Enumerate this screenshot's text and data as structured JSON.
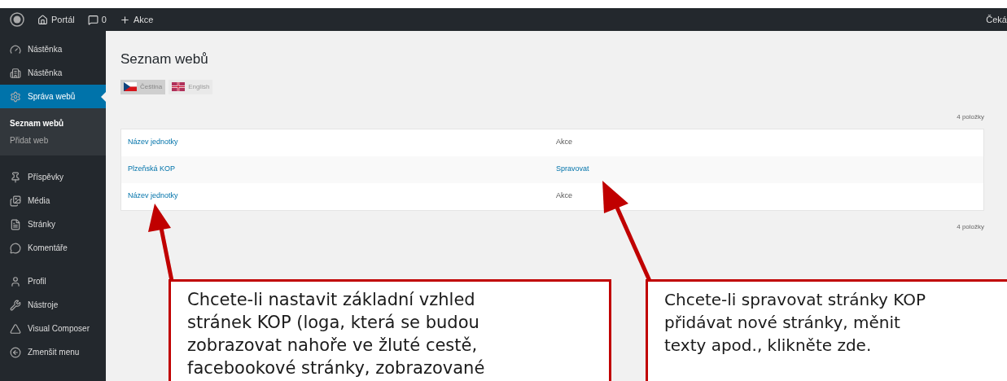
{
  "admin_bar": {
    "items": [
      {
        "kind": "home",
        "label": "Portál"
      },
      {
        "kind": "comments",
        "label": "0"
      },
      {
        "kind": "new",
        "label": "Akce"
      }
    ],
    "user": "Čeká"
  },
  "sidebar": {
    "groups": [
      [
        {
          "label": "Nástěnka",
          "selected": false
        },
        {
          "label": "Nástěnka",
          "selected": false
        },
        {
          "label": "Správa webů",
          "selected": true,
          "children": [
            {
              "label": "Seznam webů",
              "selected": true
            },
            {
              "label": "Přidat web",
              "selected": false
            }
          ]
        }
      ],
      [
        {
          "label": "Příspěvky",
          "selected": false
        },
        {
          "label": "Média",
          "selected": false
        },
        {
          "label": "Stránky",
          "selected": false
        },
        {
          "label": "Komentáře",
          "selected": false
        }
      ],
      [
        {
          "label": "Profil",
          "selected": false
        },
        {
          "label": "Nástroje",
          "selected": false
        },
        {
          "label": "Visual Composer",
          "selected": false
        },
        {
          "label": "Zmenšit menu",
          "selected": false
        }
      ]
    ]
  },
  "page": {
    "title": "Seznam webů",
    "languages": [
      {
        "kind": "cz",
        "label": "Čeština",
        "selected": true
      },
      {
        "kind": "en",
        "label": "English",
        "selected": false
      }
    ],
    "count_top": "4 položky",
    "rows": [
      {
        "name": "Název jednotky",
        "action": "Akce",
        "action_is_link": false
      },
      {
        "name": "Plzeňská KOP",
        "action": "Spravovat",
        "action_is_link": true
      },
      {
        "name": "Název jednotky",
        "action": "Akce",
        "action_is_link": false
      }
    ],
    "count_bottom": "4 položky"
  },
  "callouts": [
    {
      "lines": [
        "Chcete-li nastavit základní vzhled",
        "stránek KOP (loga, která se budou",
        "zobrazovat nahoře ve žluté cestě,",
        "facebookové stránky, zobrazované"
      ]
    },
    {
      "lines": [
        "Chcete-li spravovat stránky KOP",
        "přidávat nové stránky, měnit",
        "texty apod., klikněte zde."
      ]
    }
  ]
}
